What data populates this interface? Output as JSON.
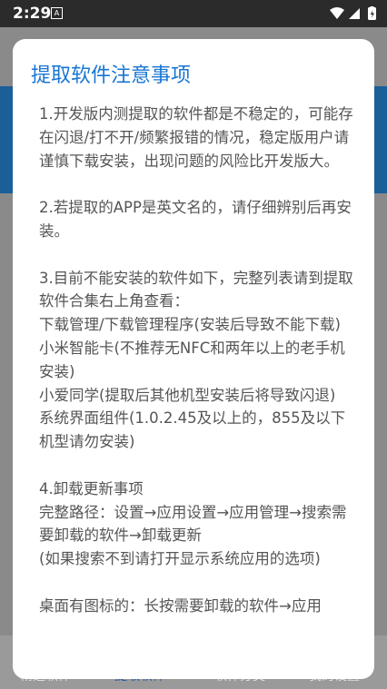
{
  "status_bar": {
    "time": "2:29",
    "notification_badge": "A"
  },
  "background": {
    "tabs": [
      {
        "label": "精选软件",
        "active": false
      },
      {
        "label": "提取软件",
        "active": true
      },
      {
        "label": "软件分类",
        "active": false
      },
      {
        "label": "我的设置",
        "active": false
      }
    ]
  },
  "dialog": {
    "title": "提取软件注意事项",
    "paragraphs": [
      "1.开发版内测提取的软件都是不稳定的，可能存在闪退/打不开/频繁报错的情况，稳定版用户请谨慎下载安装，出现问题的风险比开发版大。",
      "2.若提取的APP是英文名的，请仔细辨别后再安装。",
      "3.目前不能安装的软件如下，完整列表请到提取软件合集右上角查看：",
      "  下载管理/下载管理程序(安装后导致不能下载)",
      "  小米智能卡(不推荐无NFC和两年以上的老手机安装)",
      "  小爱同学(提取后其他机型安装后将导致闪退)",
      "   系统界面组件(1.0.2.45及以上的，855及以下机型请勿安装)",
      "4.卸载更新事项",
      "完整路径：设置→应用设置→应用管理→搜索需要卸载的软件→卸载更新",
      "   (如果搜索不到请打开显示系统应用的选项)",
      "桌面有图标的：长按需要卸载的软件→应用"
    ]
  }
}
